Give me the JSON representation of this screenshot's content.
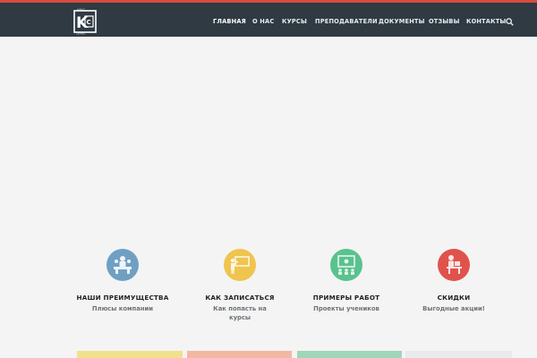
{
  "header": {
    "logo_alt": "Класс Сервис",
    "nav": [
      {
        "label": "ГЛАВНАЯ",
        "active": true
      },
      {
        "label": "О НАС"
      },
      {
        "label": "КУРСЫ"
      },
      {
        "label": "ПРЕПОДАВАТЕЛИ"
      },
      {
        "label": "ДОКУМЕНТЫ"
      },
      {
        "label": "ОТЗЫВЫ"
      },
      {
        "label": "КОНТАКТЫ"
      }
    ],
    "search_icon": "search-icon"
  },
  "features": [
    {
      "title": "НАШИ ПРЕИМУЩЕСТВА",
      "subtitle": "Плюсы компании",
      "color": "#6fa0c4",
      "icon": "meeting-icon"
    },
    {
      "title": "КАК ЗАПИСАТЬСЯ",
      "subtitle": "Как попасть на курсы",
      "color": "#efc44f",
      "icon": "teacher-board-icon"
    },
    {
      "title": "ПРИМЕРЫ РАБОТ",
      "subtitle": "Проекты  учеников",
      "color": "#59c28e",
      "icon": "presentation-icon"
    },
    {
      "title": "СКИДКИ",
      "subtitle": "Выгодные акции!",
      "color": "#e0534c",
      "icon": "student-desk-icon"
    }
  ],
  "colors": {
    "header_bg": "#2f3a42",
    "accent": "#d84a3f",
    "page_bg": "#f4f4f4"
  }
}
